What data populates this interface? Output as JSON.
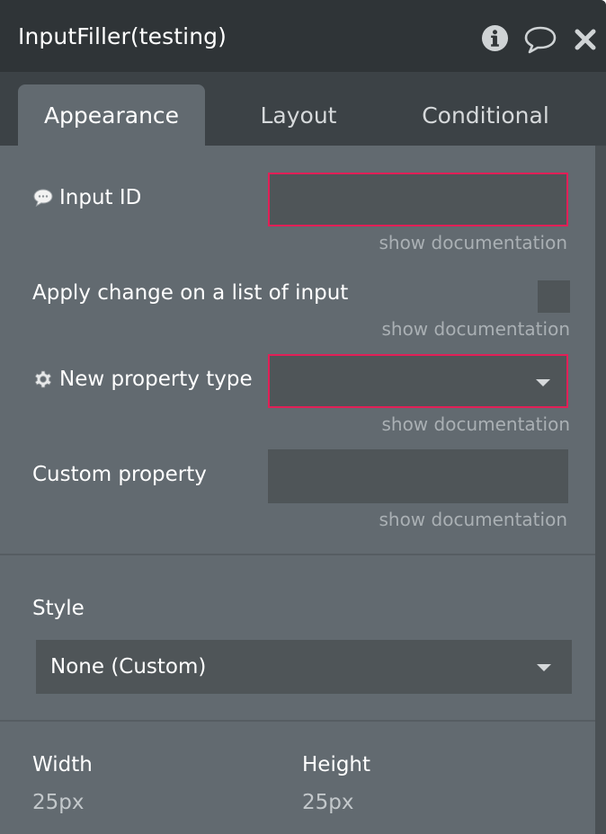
{
  "window": {
    "title": "InputFiller(testing)",
    "icons": [
      "info-icon",
      "comment-icon",
      "close-icon"
    ]
  },
  "tabs": [
    {
      "label": "Appearance",
      "active": true
    },
    {
      "label": "Layout",
      "active": false
    },
    {
      "label": "Conditional",
      "active": false
    }
  ],
  "fields": {
    "input_id": {
      "label": "Input ID",
      "icon": "speech-bubble-icon",
      "value": "",
      "required": true,
      "doc_link": "show documentation"
    },
    "apply_list": {
      "label": "Apply change on a list of input",
      "checked": false,
      "doc_link": "show documentation"
    },
    "new_property_type": {
      "label": "New property type",
      "icon": "gear-icon",
      "value": "",
      "required": true,
      "doc_link": "show documentation"
    },
    "custom_property": {
      "label": "Custom property",
      "value": "",
      "doc_link": "show documentation"
    }
  },
  "style": {
    "label": "Style",
    "selected": "None (Custom)"
  },
  "dimensions": {
    "width_label": "Width",
    "width_value": "25px",
    "height_label": "Height",
    "height_value": "25px"
  },
  "colors": {
    "titlebar": "#2f3437",
    "tabbar": "#3c4246",
    "panel": "#626a70",
    "field": "#4f5558",
    "required_border": "#e21f57"
  }
}
